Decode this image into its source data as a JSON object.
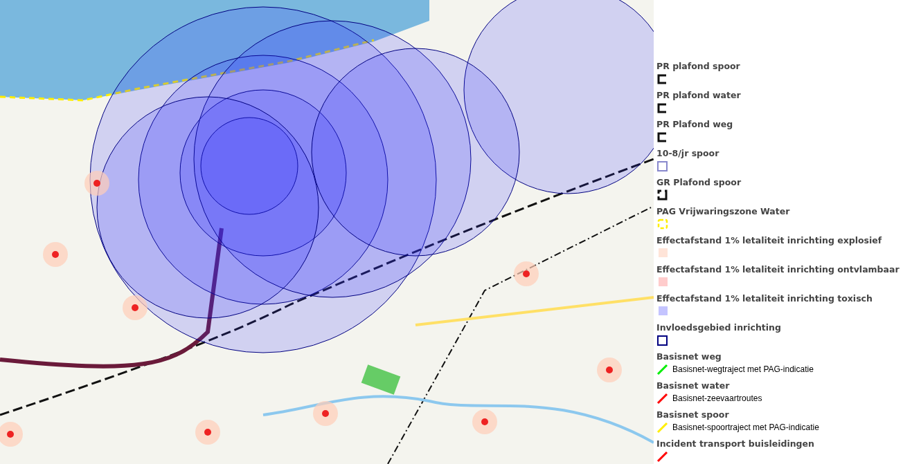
{
  "legend": [
    {
      "title": "PR plafond spoor",
      "kind": "bracket",
      "color": "#111111"
    },
    {
      "title": "PR plafond water",
      "kind": "bracket",
      "color": "#111111"
    },
    {
      "title": "PR Plafond weg",
      "kind": "bracket",
      "color": "#111111"
    },
    {
      "title": "10-8/jr spoor",
      "kind": "outline",
      "color": "#8888cc"
    },
    {
      "title": "GR Plafond spoor",
      "kind": "corner",
      "color": "#111111"
    },
    {
      "title": "PAG Vrijwaringszone Water",
      "kind": "dashed",
      "color": "#ffee00"
    },
    {
      "title": "Effectafstand 1% letaliteit inrichting explosief",
      "kind": "swatch",
      "color": "#ffe4d8"
    },
    {
      "title": "Effectafstand 1% letaliteit inrichting ontvlambaar",
      "kind": "swatch",
      "color": "#ffcccc"
    },
    {
      "title": "Effectafstand 1% letaliteit inrichting toxisch",
      "kind": "swatch",
      "color": "#c4c4ff"
    },
    {
      "title": "Invloedsgebied inrichting",
      "kind": "outline",
      "color": "#000080"
    },
    {
      "title": "Basisnet weg",
      "kind": "line",
      "color": "#00ee00",
      "label": "Basisnet-wegtraject met PAG-indicatie"
    },
    {
      "title": "Basisnet water",
      "kind": "line",
      "color": "#ff0000",
      "label": "Basisnet-zeevaartroutes"
    },
    {
      "title": "Basisnet spoor",
      "kind": "line",
      "color": "#ffee00",
      "label": "Basisnet-spoortraject met PAG-indicatie"
    },
    {
      "title": "Incident transport buisleidingen",
      "kind": "line",
      "color": "#ff0000"
    }
  ]
}
